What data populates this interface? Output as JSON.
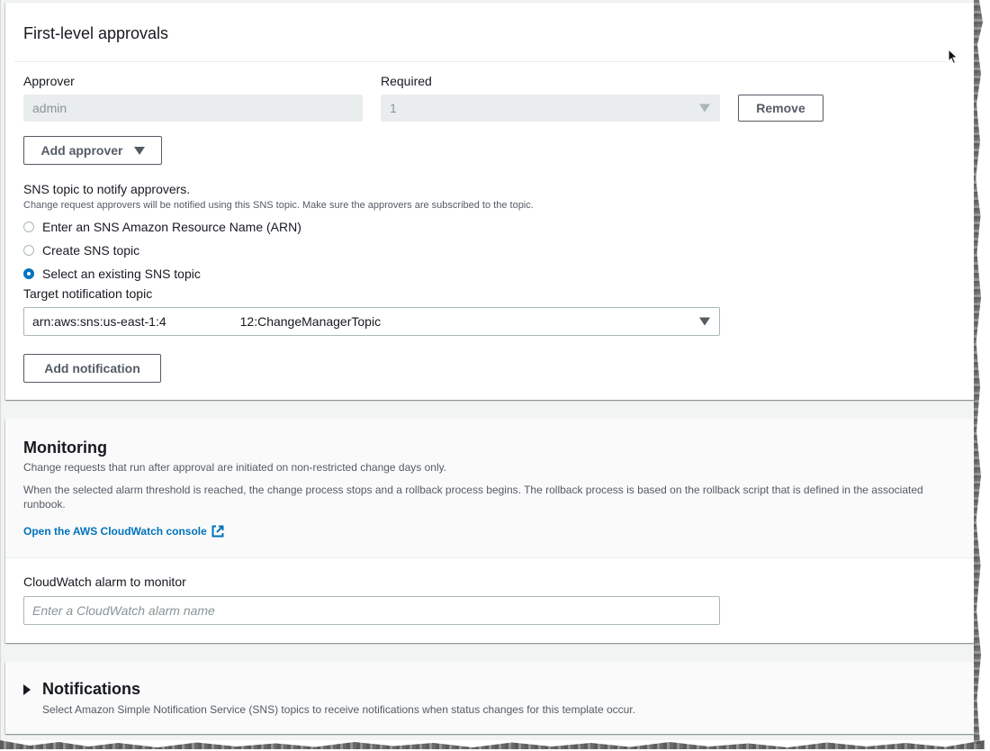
{
  "approvals": {
    "title": "First-level approvals",
    "approver_label": "Approver",
    "approver_value": "admin",
    "required_label": "Required",
    "required_value": "1",
    "remove_button": "Remove",
    "add_approver_button": "Add approver",
    "sns_title": "SNS topic to notify approvers.",
    "sns_description": "Change request approvers will be notified using this SNS topic. Make sure the approvers are subscribed to the topic.",
    "radio_options": [
      {
        "label": "Enter an SNS Amazon Resource Name (ARN)",
        "checked": false
      },
      {
        "label": "Create SNS topic",
        "checked": false
      },
      {
        "label": "Select an existing SNS topic",
        "checked": true
      }
    ],
    "target_label": "Target notification topic",
    "target_value_prefix": "arn:aws:sns:us-east-1:4",
    "target_value_suffix": "12:ChangeManagerTopic",
    "add_notification_button": "Add notification"
  },
  "monitoring": {
    "title": "Monitoring",
    "description_1": "Change requests that run after approval are initiated on non-restricted change days only.",
    "description_2": "When the selected alarm threshold is reached, the change process stops and a rollback process begins. The rollback process is based on the rollback script that is defined in the associated runbook.",
    "console_link": "Open the AWS CloudWatch console",
    "alarm_label": "CloudWatch alarm to monitor",
    "alarm_placeholder": "Enter a CloudWatch alarm name",
    "alarm_value": ""
  },
  "notifications": {
    "title": "Notifications",
    "description": "Select Amazon Simple Notification Service (SNS) topics to receive notifications when status changes for this template occur.",
    "expanded": false
  },
  "colors": {
    "link": "#0073bb",
    "radio_checked": "#0073bb",
    "background": "#f2f3f3"
  }
}
